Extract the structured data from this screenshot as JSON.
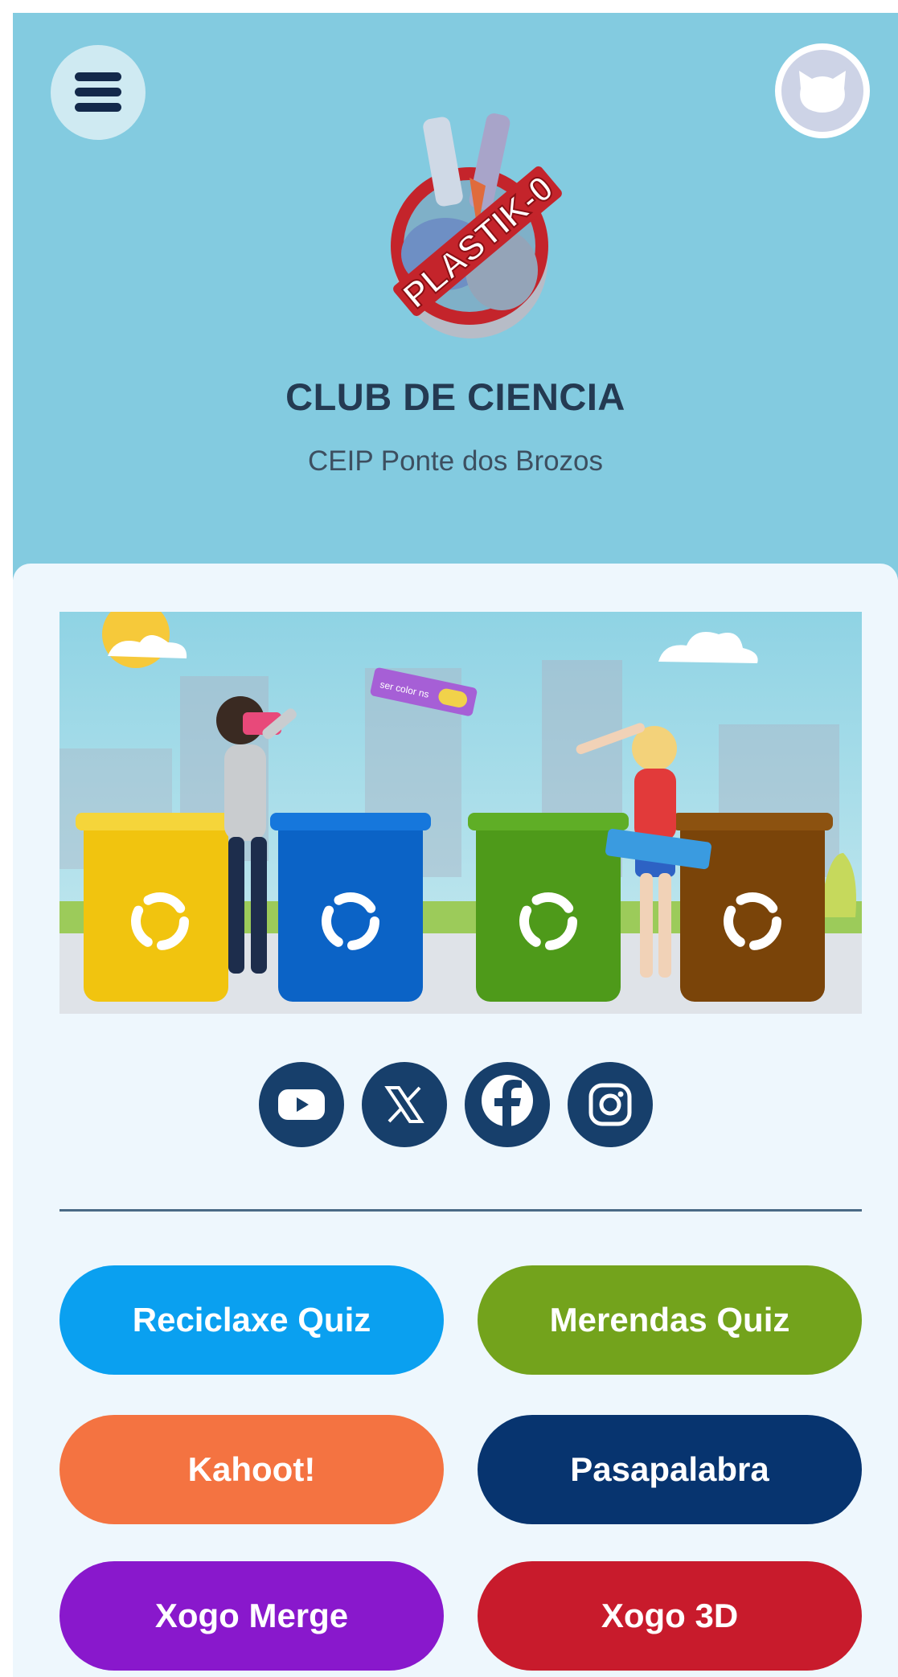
{
  "header": {
    "title": "CLUB DE CIENCIA",
    "subtitle": "CEIP Ponte dos Brozos",
    "logo_text": "PLASTIK-0",
    "menu_icon": "hamburger-menu-icon",
    "avatar_icon": "cat-avatar-icon",
    "background_color": "#83cbe0"
  },
  "hero": {
    "block_label": "ser color ns",
    "bin_colors": [
      "#f1c40f",
      "#0b63c6",
      "#4e9a1a",
      "#7a4409"
    ],
    "recycle_icon": "recycle-icon"
  },
  "social": [
    {
      "name": "youtube",
      "icon": "youtube-icon"
    },
    {
      "name": "x",
      "icon": "x-icon"
    },
    {
      "name": "facebook",
      "icon": "facebook-icon"
    },
    {
      "name": "instagram",
      "icon": "instagram-icon"
    }
  ],
  "buttons": [
    {
      "label": "Reciclaxe Quiz",
      "color": "#0aa0f0"
    },
    {
      "label": "Merendas Quiz",
      "color": "#73a31c"
    },
    {
      "label": "Kahoot!",
      "color": "#f47341"
    },
    {
      "label": "Pasapalabra",
      "color": "#07346f"
    },
    {
      "label": "Xogo Merge",
      "color": "#8918cc"
    },
    {
      "label": "Xogo 3D",
      "color": "#c81b2c"
    }
  ]
}
